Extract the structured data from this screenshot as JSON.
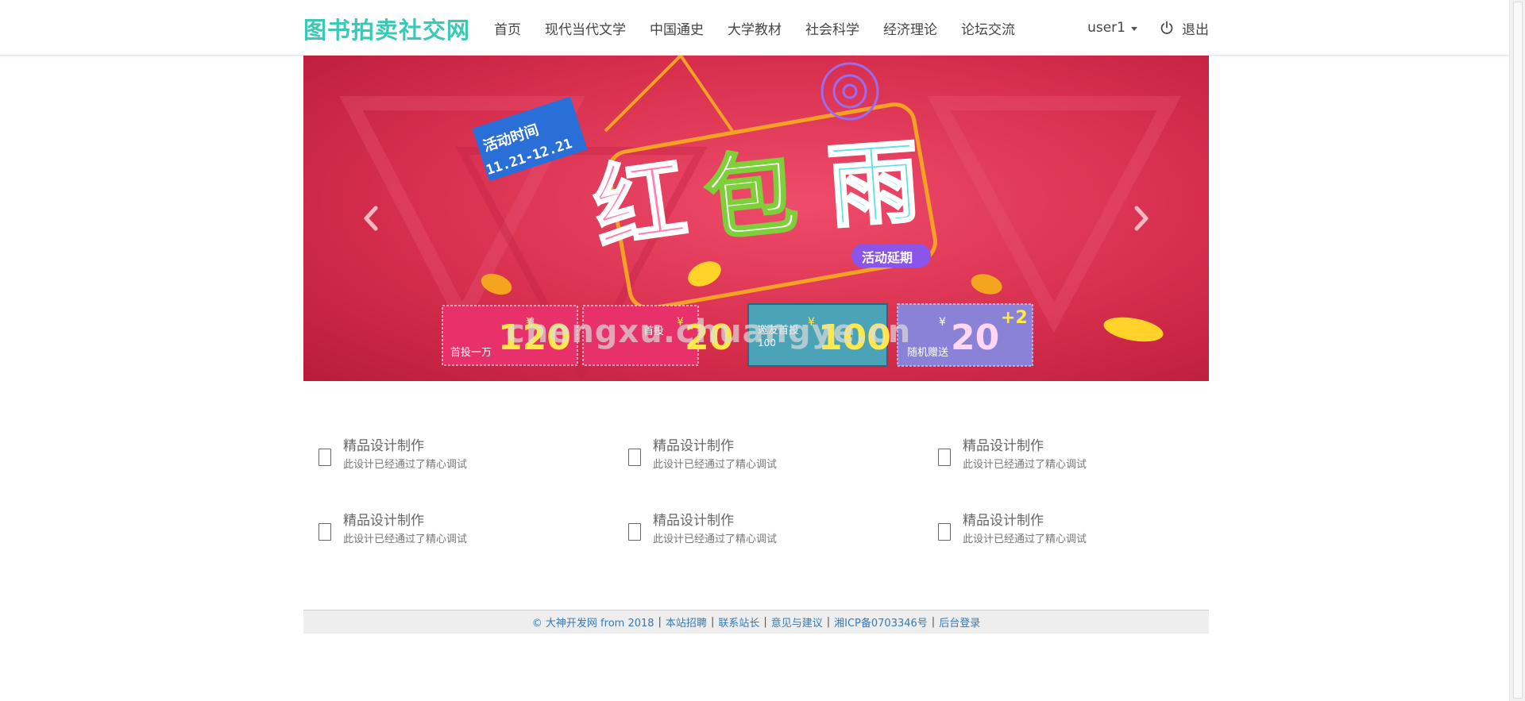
{
  "navbar": {
    "brand": "图书拍卖社交网",
    "links": [
      {
        "label": "首页"
      },
      {
        "label": "现代当代文学"
      },
      {
        "label": "中国通史"
      },
      {
        "label": "大学教材"
      },
      {
        "label": "社会科学"
      },
      {
        "label": "经济理论"
      },
      {
        "label": "论坛交流"
      }
    ],
    "user": "user1",
    "logout": "退出"
  },
  "banner": {
    "date_title": "活动时间",
    "date_range": "11.21-12.21",
    "headline_1": "红",
    "headline_2": "包",
    "headline_3": "雨",
    "extension": "活动延期",
    "currency": "¥",
    "coupons": [
      {
        "label": "首投一万",
        "value": "120"
      },
      {
        "label": "首投",
        "value": "20"
      },
      {
        "label": "邀友首投",
        "sub": "100",
        "value": "100"
      },
      {
        "label": "随机赠送",
        "value": "20",
        "extra": "+2"
      }
    ],
    "watermark": "chengxu.chuangye.cn",
    "colors": {
      "background": "#d82f4e",
      "headline_pink": "#ff7fae",
      "headline_cyan": "#5fe0e8",
      "date_badge": "#2a6fd8"
    }
  },
  "features": [
    {
      "title": "精品设计制作",
      "desc": "此设计已经通过了精心调试"
    },
    {
      "title": "精品设计制作",
      "desc": "此设计已经通过了精心调试"
    },
    {
      "title": "精品设计制作",
      "desc": "此设计已经通过了精心调试"
    },
    {
      "title": "精品设计制作",
      "desc": "此设计已经通过了精心调试"
    },
    {
      "title": "精品设计制作",
      "desc": "此设计已经通过了精心调试"
    },
    {
      "title": "精品设计制作",
      "desc": "此设计已经通过了精心调试"
    }
  ],
  "footer": {
    "copyright": "© 大神开发网 from 2018",
    "links": [
      "本站招聘",
      "联系站长",
      "意见与建议",
      "湘ICP备0703346号",
      "后台登录"
    ]
  }
}
